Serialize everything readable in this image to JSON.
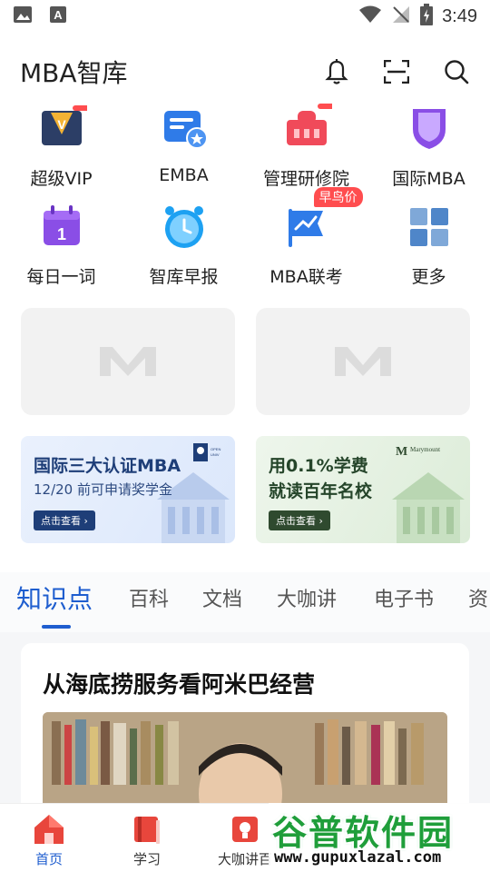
{
  "status_bar": {
    "time": "3:49",
    "left_icons": [
      "image-icon",
      "font-icon"
    ],
    "right_icons": [
      "wifi-icon",
      "no-signal-icon",
      "battery-charging-icon"
    ]
  },
  "header": {
    "title": "MBA智库",
    "icons": [
      "bell-icon",
      "scan-icon",
      "search-icon"
    ]
  },
  "quick_grid": {
    "items": [
      {
        "label": "超级VIP",
        "icon": "vip-badge-icon"
      },
      {
        "label": "EMBA",
        "icon": "certificate-icon"
      },
      {
        "label": "管理研修院",
        "icon": "institute-icon"
      },
      {
        "label": "国际MBA",
        "icon": "shield-icon"
      },
      {
        "label": "每日一词",
        "icon": "calendar-icon"
      },
      {
        "label": "智库早报",
        "icon": "alarm-clock-icon"
      },
      {
        "label": "MBA联考",
        "icon": "flag-chart-icon",
        "tag": "早鸟价"
      },
      {
        "label": "更多",
        "icon": "grid-more-icon"
      }
    ]
  },
  "banners": [
    {
      "line1": "国际三大认证MBA",
      "line2": "12/20 前可申请奖学金",
      "button": "点击查看 ›",
      "logo_text": "OPEN UNIVERSITY"
    },
    {
      "line1": "用0.1%学费",
      "line2": "就读百年名校",
      "button": "点击查看 ›",
      "logo_text": "Marymount"
    }
  ],
  "tabs": [
    {
      "label": "知识点",
      "active": true
    },
    {
      "label": "百科",
      "active": false
    },
    {
      "label": "文档",
      "active": false
    },
    {
      "label": "大咖讲",
      "active": false
    },
    {
      "label": "电子书",
      "active": false
    },
    {
      "label": "资",
      "active": false
    }
  ],
  "feed": {
    "cards": [
      {
        "title": "从海底捞服务看阿米巴经营"
      }
    ]
  },
  "bottom_nav": {
    "items": [
      {
        "label": "首页",
        "icon": "home-icon",
        "active": true
      },
      {
        "label": "学习",
        "icon": "book-icon",
        "active": false
      },
      {
        "label": "大咖讲百",
        "icon": "lecture-icon",
        "active": false
      }
    ]
  },
  "watermark": {
    "top": "谷普软件园",
    "bottom": "www.gupuxlazal.com"
  },
  "colors": {
    "accent": "#1f5ecf",
    "promo_red": "#ff4d4f",
    "placeholder": "#f2f2f2"
  }
}
